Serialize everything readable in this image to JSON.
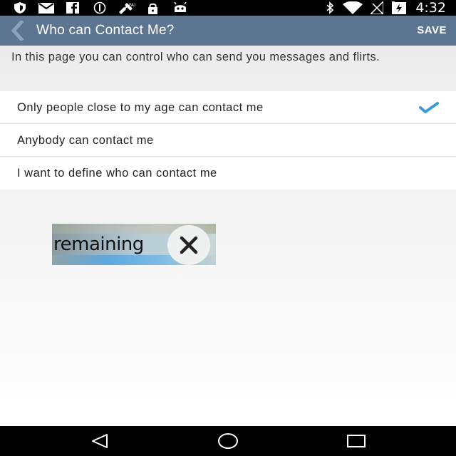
{
  "status_bar": {
    "time": "4:32",
    "left_icons": [
      "shield-icon",
      "mail-icon",
      "facebook-icon",
      "do-not-disturb-icon",
      "satellite-icon",
      "lock-icon",
      "android-icon"
    ],
    "right_icons": [
      "bluetooth-icon",
      "wifi-icon",
      "no-signal-icon",
      "battery-charging-icon"
    ]
  },
  "app_bar": {
    "title": "Who can Contact Me?",
    "save_label": "SAVE",
    "color": "#5c7591"
  },
  "intro_text": "In this page you can control who can send you messages and flirts.",
  "options": [
    {
      "label": "Only people close to my age can contact me",
      "selected": true
    },
    {
      "label": "Anybody can contact me",
      "selected": false
    },
    {
      "label": "I want to define who can contact me",
      "selected": false
    }
  ],
  "check_color": "#3d9ad8",
  "toast": {
    "text": "remaining"
  },
  "nav_bar": {
    "buttons": [
      "back-icon",
      "home-icon",
      "recents-icon"
    ]
  }
}
